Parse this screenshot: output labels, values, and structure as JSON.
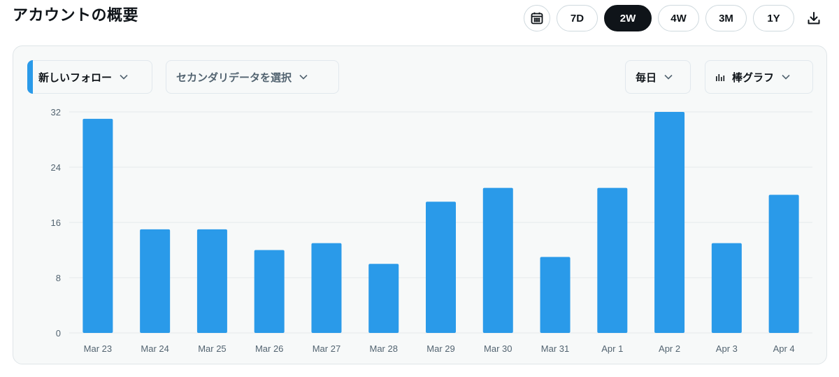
{
  "header": {
    "title": "アカウントの概要",
    "ranges": [
      "7D",
      "2W",
      "4W",
      "3M",
      "1Y"
    ],
    "active_range": "2W"
  },
  "controls": {
    "metric": "新しいフォロー",
    "secondary": "セカンダリデータを選択",
    "interval": "毎日",
    "chart_type": "棒グラフ"
  },
  "colors": {
    "bar": "#2a9ae9",
    "active_pill": "#0f1419",
    "accent": "#2a9ae9"
  },
  "icons": {
    "calendar": "calendar-icon",
    "download": "download-icon",
    "chart_type": "bar-chart-icon",
    "dropdown": "chevron-down-icon"
  },
  "chart_data": {
    "type": "bar",
    "categories": [
      "Mar 23",
      "Mar 24",
      "Mar 25",
      "Mar 26",
      "Mar 27",
      "Mar 28",
      "Mar 29",
      "Mar 30",
      "Mar 31",
      "Apr 1",
      "Apr 2",
      "Apr 3",
      "Apr 4"
    ],
    "series": [
      {
        "values": [
          31,
          15,
          15,
          12,
          13,
          10,
          19,
          21,
          11,
          21,
          32,
          13,
          20
        ]
      }
    ],
    "yticks": [
      "0",
      "8",
      "16",
      "24",
      "32"
    ],
    "ylim": [
      0,
      32
    ],
    "grid": true,
    "legend": "none"
  }
}
